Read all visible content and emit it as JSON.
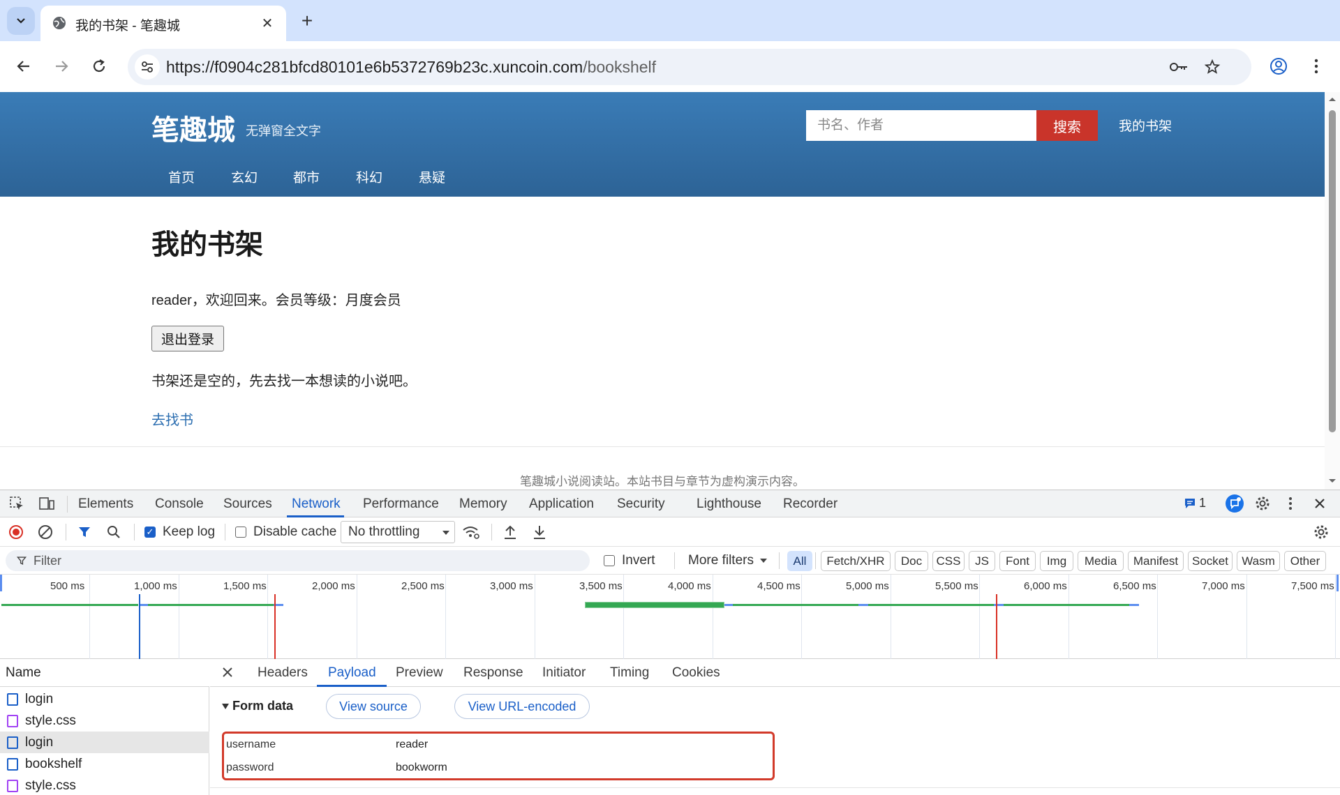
{
  "browser": {
    "tab_title": "我的书架 - 笔趣城",
    "url_host": "https://f0904c281bfcd80101e6b5372769b23c.xuncoin.com",
    "url_path": "/bookshelf"
  },
  "site": {
    "logo": "笔趣城",
    "tagline": "无弹窗全文字",
    "search_placeholder": "书名、作者",
    "search_button": "搜索",
    "my_shelf": "我的书架",
    "nav": [
      "首页",
      "玄幻",
      "都市",
      "科幻",
      "悬疑"
    ]
  },
  "page": {
    "title": "我的书架",
    "welcome": "reader，欢迎回来。会员等级：月度会员",
    "logout": "退出登录",
    "empty_message": "书架还是空的，先去找一本想读的小说吧。",
    "find_books": "去找书",
    "footer": "笔趣城小说阅读站。本站书目与章节为虚构演示内容。"
  },
  "devtools": {
    "tabs": [
      "Elements",
      "Console",
      "Sources",
      "Network",
      "Performance",
      "Memory",
      "Application",
      "Security",
      "Lighthouse",
      "Recorder"
    ],
    "active_tab": "Network",
    "issues_count": "1",
    "toolbar": {
      "keep_log": "Keep log",
      "keep_log_checked": true,
      "disable_cache": "Disable cache",
      "disable_cache_checked": false,
      "throttling": "No throttling"
    },
    "filter": {
      "placeholder": "Filter",
      "invert": "Invert",
      "more_filters": "More filters",
      "types": [
        "All",
        "Fetch/XHR",
        "Doc",
        "CSS",
        "JS",
        "Font",
        "Img",
        "Media",
        "Manifest",
        "Socket",
        "Wasm",
        "Other"
      ],
      "active_type": "All"
    },
    "timeline_ticks": [
      "500 ms",
      "1,000 ms",
      "1,500 ms",
      "2,000 ms",
      "2,500 ms",
      "3,000 ms",
      "3,500 ms",
      "4,000 ms",
      "4,500 ms",
      "5,000 ms",
      "5,500 ms",
      "6,000 ms",
      "6,500 ms",
      "7,000 ms",
      "7,500 ms"
    ],
    "requests_header": "Name",
    "requests": [
      {
        "name": "login",
        "type": "doc",
        "selected": false
      },
      {
        "name": "style.css",
        "type": "css",
        "selected": false
      },
      {
        "name": "login",
        "type": "doc",
        "selected": true
      },
      {
        "name": "bookshelf",
        "type": "doc",
        "selected": false
      },
      {
        "name": "style.css",
        "type": "css",
        "selected": false
      }
    ],
    "detail_tabs": [
      "Headers",
      "Payload",
      "Preview",
      "Response",
      "Initiator",
      "Timing",
      "Cookies"
    ],
    "active_detail_tab": "Payload",
    "payload": {
      "section_title": "Form data",
      "view_source": "View source",
      "view_url_encoded": "View URL-encoded",
      "fields": [
        {
          "key": "username",
          "value": "reader"
        },
        {
          "key": "password",
          "value": "bookworm"
        }
      ]
    }
  },
  "colors": {
    "header_blue": "#3a7cb7",
    "search_red": "#c9342a",
    "devtools_accent": "#1a5fc8",
    "highlight_box": "#d23a2a"
  }
}
